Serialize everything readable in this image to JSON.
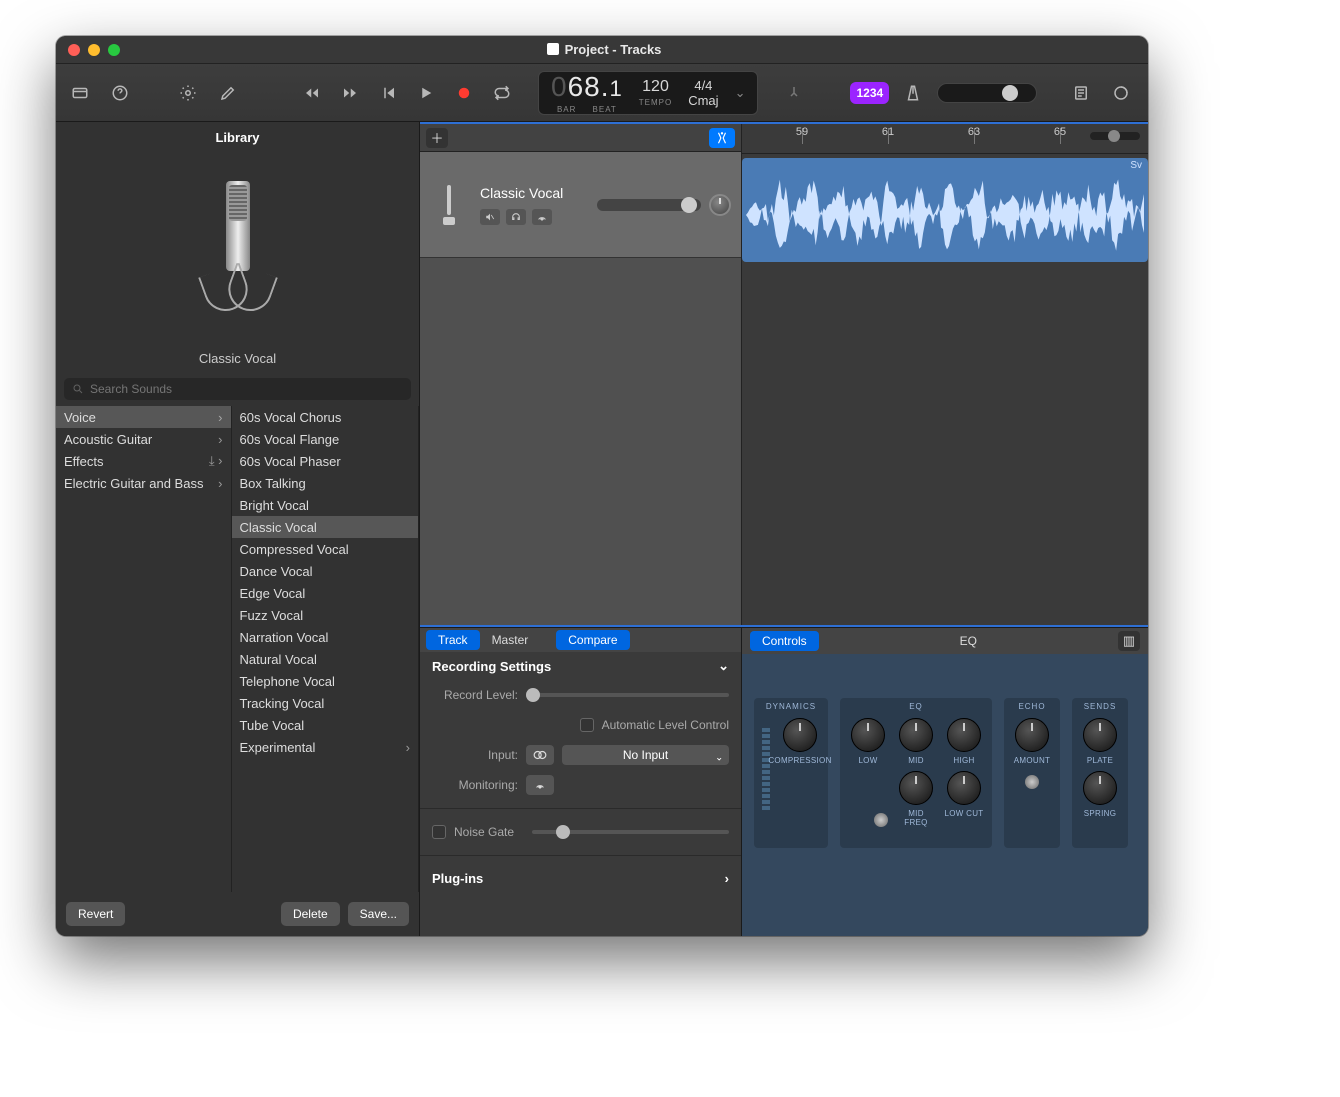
{
  "title": "Project - Tracks",
  "toolbar": {
    "lcd": {
      "bar_prefix": "0",
      "bar": "68",
      "beat": "1",
      "bar_label": "BAR",
      "beat_label": "BEAT",
      "tempo": "120",
      "tempo_label": "TEMPO",
      "timesig": "4/4",
      "key": "Cmaj"
    },
    "badge": "1234"
  },
  "library": {
    "title": "Library",
    "preset_name": "Classic Vocal",
    "search_placeholder": "Search Sounds",
    "categories": [
      {
        "label": "Voice",
        "has_children": true,
        "selected": true
      },
      {
        "label": "Acoustic Guitar",
        "has_children": true
      },
      {
        "label": "Effects",
        "has_children": true,
        "download": true
      },
      {
        "label": "Electric Guitar and Bass",
        "has_children": true
      }
    ],
    "presets": [
      {
        "label": "60s Vocal Chorus"
      },
      {
        "label": "60s Vocal Flange"
      },
      {
        "label": "60s Vocal Phaser"
      },
      {
        "label": "Box Talking"
      },
      {
        "label": "Bright Vocal"
      },
      {
        "label": "Classic Vocal",
        "selected": true
      },
      {
        "label": "Compressed Vocal"
      },
      {
        "label": "Dance Vocal"
      },
      {
        "label": "Edge Vocal"
      },
      {
        "label": "Fuzz Vocal"
      },
      {
        "label": "Narration Vocal"
      },
      {
        "label": "Natural Vocal"
      },
      {
        "label": "Telephone Vocal"
      },
      {
        "label": "Tracking Vocal"
      },
      {
        "label": "Tube Vocal"
      },
      {
        "label": "Experimental",
        "has_children": true
      }
    ],
    "footer": {
      "revert": "Revert",
      "delete": "Delete",
      "save": "Save..."
    }
  },
  "tracks": {
    "track1_name": "Classic Vocal",
    "region_label": "Sv"
  },
  "ruler": [
    "59",
    "61",
    "63",
    "65"
  ],
  "smart": {
    "tabs": {
      "track": "Track",
      "master": "Master",
      "compare": "Compare",
      "controls": "Controls",
      "eq": "EQ"
    },
    "section_recording": "Recording Settings",
    "labels": {
      "record_level": "Record Level:",
      "auto_level": "Automatic Level Control",
      "input": "Input:",
      "input_value": "No Input",
      "monitoring": "Monitoring:",
      "noise_gate": "Noise Gate",
      "plugins": "Plug-ins"
    }
  },
  "rack": {
    "groups": [
      {
        "name": "DYNAMICS",
        "knobs": [
          "COMPRESSION"
        ]
      },
      {
        "name": "EQ",
        "knobs": [
          "LOW",
          "MID",
          "HIGH",
          "MID FREQ",
          "LOW CUT"
        ]
      },
      {
        "name": "ECHO",
        "knobs": [
          "AMOUNT"
        ]
      },
      {
        "name": "SENDS",
        "knobs": [
          "PLATE",
          "SPRING"
        ]
      }
    ]
  }
}
